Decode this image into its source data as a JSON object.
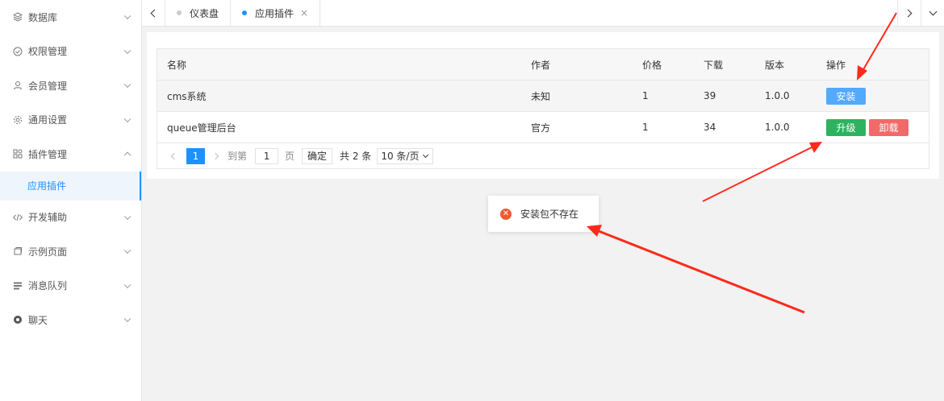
{
  "sidebar": {
    "items": [
      {
        "label": "数据库",
        "icon": "layers-icon"
      },
      {
        "label": "权限管理",
        "icon": "shield-check-icon"
      },
      {
        "label": "会员管理",
        "icon": "user-icon"
      },
      {
        "label": "通用设置",
        "icon": "gear-icon"
      },
      {
        "label": "插件管理",
        "icon": "plugin-icon"
      },
      {
        "label": "开发辅助",
        "icon": "code-icon"
      },
      {
        "label": "示例页面",
        "icon": "page-icon"
      },
      {
        "label": "消息队列",
        "icon": "list-icon"
      },
      {
        "label": "聊天",
        "icon": "chat-icon"
      }
    ],
    "sub_item": "应用插件"
  },
  "tabs": [
    {
      "label": "仪表盘",
      "active": false
    },
    {
      "label": "应用插件",
      "active": true,
      "close": "×"
    }
  ],
  "table": {
    "headers": [
      "名称",
      "作者",
      "价格",
      "下载",
      "版本",
      "操作"
    ],
    "rows": [
      {
        "name": "cms系统",
        "author": "未知",
        "price": "1",
        "downloads": "39",
        "version": "1.0.0",
        "actions": [
          "安装"
        ]
      },
      {
        "name": "queue管理后台",
        "author": "官方",
        "price": "1",
        "downloads": "34",
        "version": "1.0.0",
        "actions": [
          "升级",
          "卸载"
        ]
      }
    ]
  },
  "pager": {
    "current": "1",
    "goto_label": "到第",
    "goto_value": "1",
    "page_unit": "页",
    "confirm": "确定",
    "total": "共 2 条",
    "page_size": "10 条/页"
  },
  "toast": {
    "message": "安装包不存在",
    "icon": "error-icon"
  },
  "colors": {
    "accent": "#1e90ff",
    "success": "#2db35f",
    "danger": "#f06a6a",
    "error_icon": "#f25a2e",
    "annotation": "#ff2a1a"
  }
}
